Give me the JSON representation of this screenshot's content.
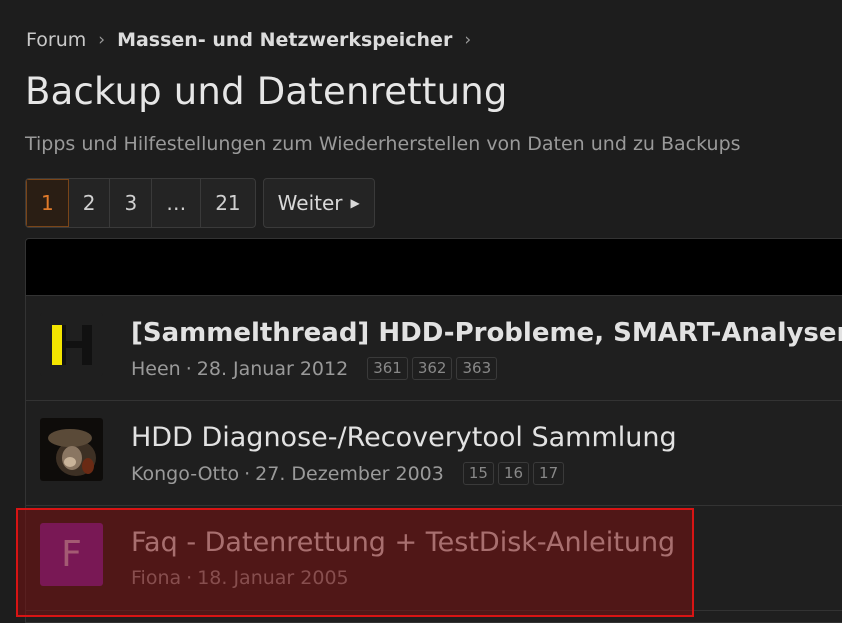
{
  "breadcrumb": {
    "items": [
      "Forum",
      "Massen- und Netzwerkspeicher"
    ],
    "sep": "›"
  },
  "page": {
    "title": "Backup und Datenrettung",
    "description": "Tipps und Hilfestellungen zum Wiederherstellen von Daten und zu Backups"
  },
  "pagination": {
    "pages": [
      "1",
      "2",
      "3",
      "…",
      "21"
    ],
    "current": "1",
    "next_label": "Weiter"
  },
  "threads": [
    {
      "title": "[Sammelthread] HDD-Probleme, SMART-Analysen",
      "author": "Heen",
      "date": "28. Januar 2012",
      "pages": [
        "361",
        "362",
        "363"
      ],
      "avatar_icon": "h-logo-icon"
    },
    {
      "title": "HDD Diagnose-/Recoverytool Sammlung",
      "author": "Kongo-Otto",
      "date": "27. Dezember 2003",
      "pages": [
        "15",
        "16",
        "17"
      ],
      "avatar_icon": "figure-avatar-icon"
    },
    {
      "title": "Faq - Datenrettung + TestDisk-Anleitung",
      "author": "Fiona",
      "date": "18. Januar 2005",
      "avatar_letter": "F",
      "avatar_color": "#7b22a8"
    }
  ],
  "meta_separator": "·",
  "colors": {
    "accent": "#e07a2a",
    "highlight_border": "#d81414"
  }
}
